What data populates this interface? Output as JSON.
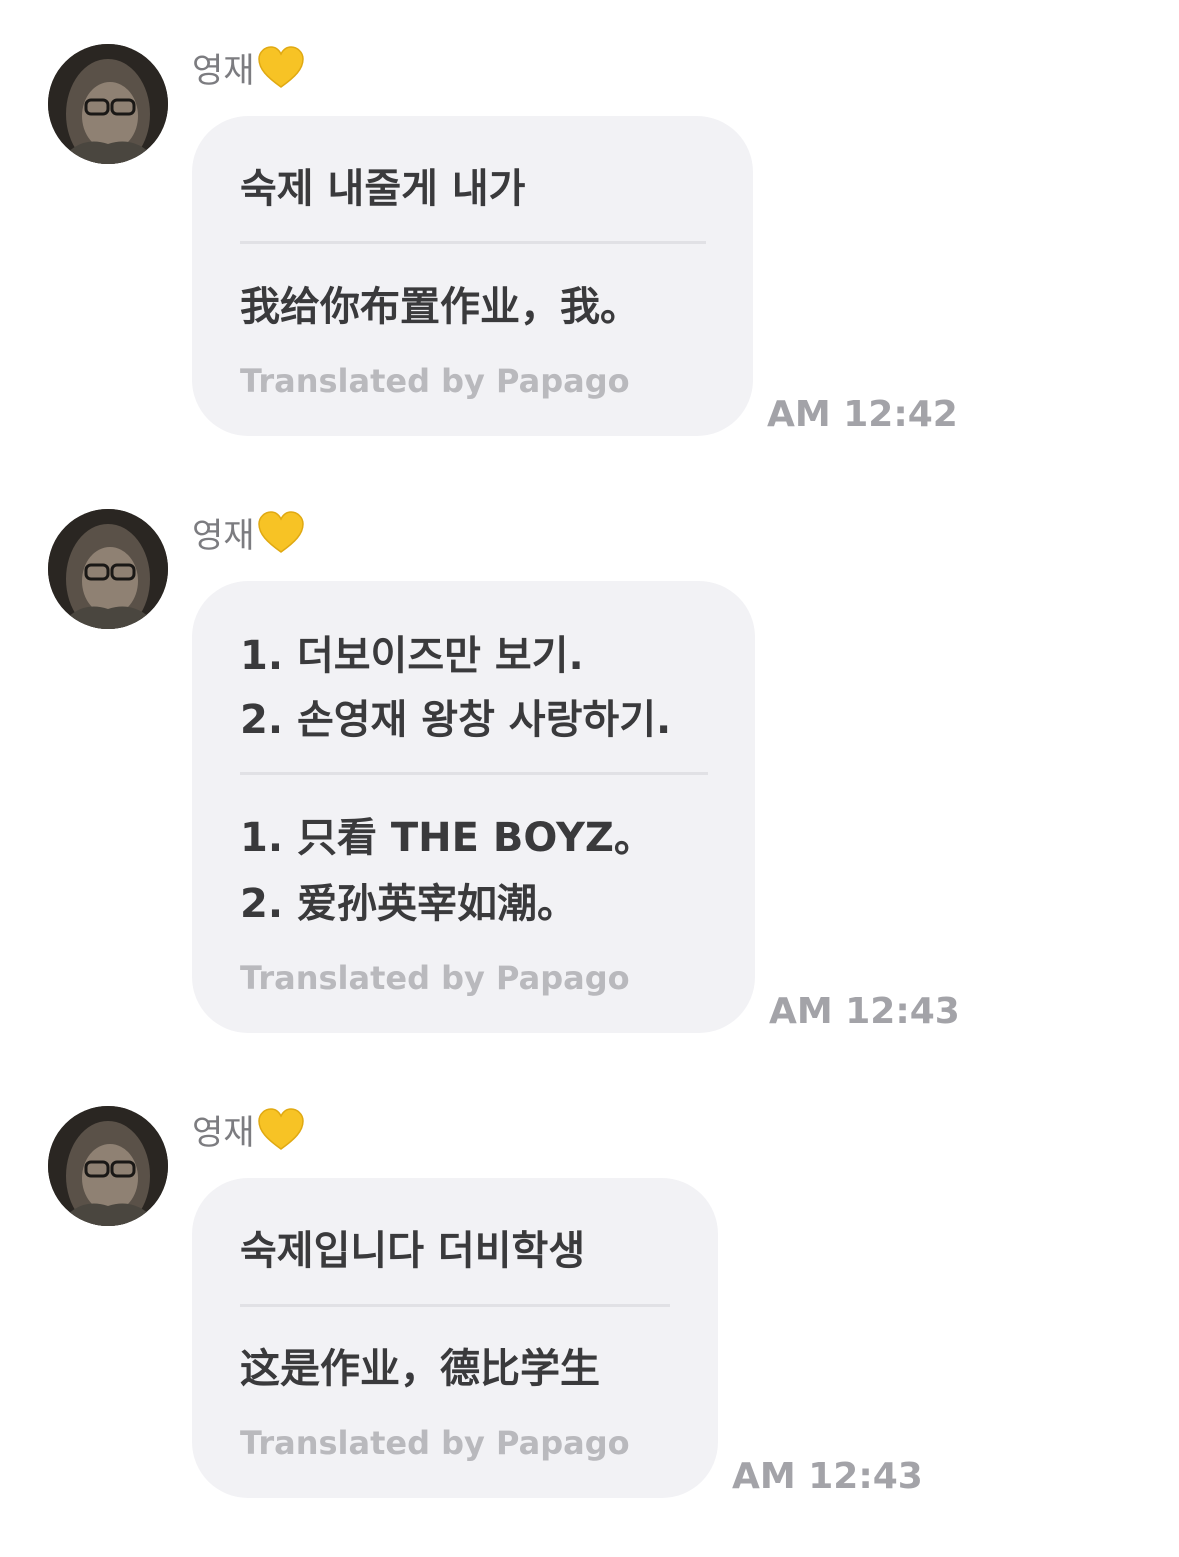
{
  "messages": [
    {
      "sender": "영재",
      "sender_icon": "yellow-heart-icon",
      "original": [
        "숙제 내줄게 내가"
      ],
      "translation": [
        "我给你布置作业，我。"
      ],
      "translated_by": "Translated by Papago",
      "time": "AM 12:42"
    },
    {
      "sender": "영재",
      "sender_icon": "yellow-heart-icon",
      "original": [
        "1. 더보이즈만 보기.",
        "2. 손영재 왕창 사랑하기."
      ],
      "translation": [
        "1. 只看 THE BOYZ。",
        "2. 爱孙英宰如潮。"
      ],
      "translated_by": "Translated by Papago",
      "time": "AM 12:43"
    },
    {
      "sender": "영재",
      "sender_icon": "yellow-heart-icon",
      "original": [
        "숙제입니다 더비학생"
      ],
      "translation": [
        "这是作业，德比学生"
      ],
      "translated_by": "Translated by Papago",
      "time": "AM 12:43"
    }
  ],
  "colors": {
    "bubble": "#f2f2f5",
    "text": "#3a3a3c",
    "sender": "#7c7c80",
    "papago": "#b9b9bd",
    "time": "#a3a3a8",
    "heart": "#f7c325"
  }
}
